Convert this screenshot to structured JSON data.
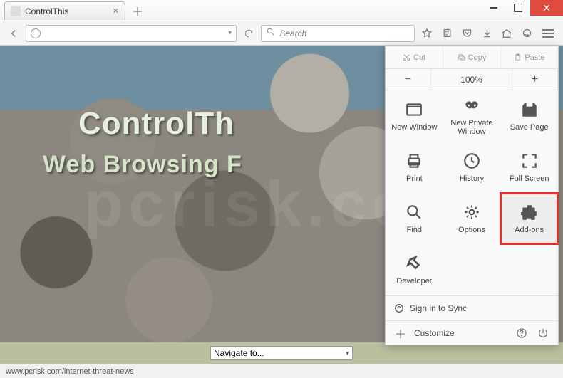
{
  "window": {
    "tab_title": "ControlThis",
    "min_tip": "Minimize",
    "max_tip": "Restore",
    "close_tip": "Close"
  },
  "nav": {
    "search_placeholder": "Search"
  },
  "page": {
    "title": "ControlTh",
    "subtitle": "Web Browsing F",
    "nav_select": "Navigate to...",
    "watermark": "pcrisk.com"
  },
  "status": {
    "text": "www.pcrisk.com/internet-threat-news"
  },
  "menu": {
    "top": {
      "cut": "Cut",
      "copy": "Copy",
      "paste": "Paste"
    },
    "zoom": {
      "minus": "−",
      "level": "100%",
      "plus": "+"
    },
    "grid": {
      "new_window": "New Window",
      "new_private": "New Private\nWindow",
      "save_page": "Save Page",
      "print": "Print",
      "history": "History",
      "full_screen": "Full Screen",
      "find": "Find",
      "options": "Options",
      "addons": "Add-ons",
      "developer": "Developer"
    },
    "sign_in": "Sign in to Sync",
    "customize": "Customize"
  }
}
